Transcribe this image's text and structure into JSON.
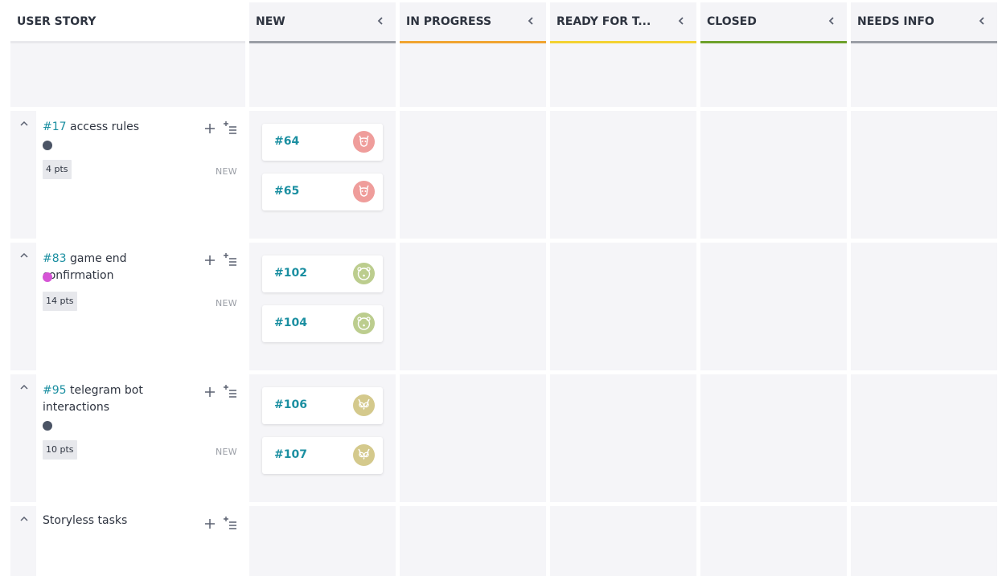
{
  "columns": {
    "user_story": "USER STORY",
    "statuses": [
      {
        "label": "NEW",
        "color": "#9a9ea6"
      },
      {
        "label": "IN PROGRESS",
        "color": "#f0a431"
      },
      {
        "label": "READY FOR T...",
        "color": "#f3d232"
      },
      {
        "label": "CLOSED",
        "color": "#6ea12b"
      },
      {
        "label": "NEEDS INFO",
        "color": "#9a9ea6"
      }
    ]
  },
  "stories": [
    {
      "ref": "#17",
      "name": "access rules",
      "tag_color": "#4b5465",
      "points": "4 pts",
      "status": "NEW",
      "tasks": [
        {
          "ref": "#64",
          "avatar_color": "#ef9d9b",
          "avatar_icon": "deer-avatar-icon"
        },
        {
          "ref": "#65",
          "avatar_color": "#ef9d9b",
          "avatar_icon": "deer-avatar-icon"
        }
      ]
    },
    {
      "ref": "#83",
      "name": "game end confirmation",
      "tag_color": "#d655d6",
      "points": "14 pts",
      "status": "NEW",
      "tasks": [
        {
          "ref": "#102",
          "avatar_color": "#bccd8e",
          "avatar_icon": "bear-avatar-icon"
        },
        {
          "ref": "#104",
          "avatar_color": "#bccd8e",
          "avatar_icon": "bear-avatar-icon"
        }
      ]
    },
    {
      "ref": "#95",
      "name": "telegram bot interactions",
      "tag_color": "#4b5465",
      "points": "10 pts",
      "status": "NEW",
      "tasks": [
        {
          "ref": "#106",
          "avatar_color": "#d4c98c",
          "avatar_icon": "owl-avatar-icon"
        },
        {
          "ref": "#107",
          "avatar_color": "#d4c98c",
          "avatar_icon": "owl-avatar-icon"
        }
      ]
    }
  ],
  "storyless": "Storyless tasks"
}
